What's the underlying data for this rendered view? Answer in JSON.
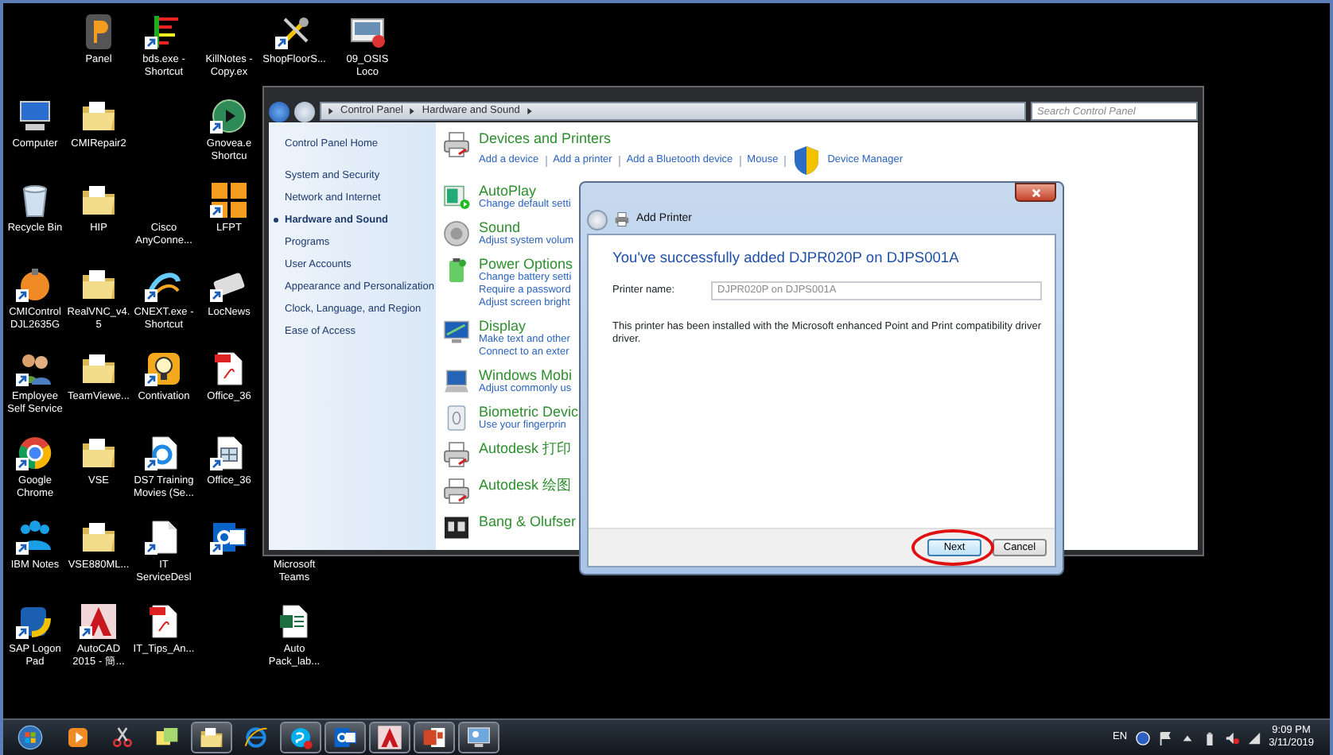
{
  "desktop_rows": [
    [
      null,
      {
        "label": "Panel",
        "kind": "tile",
        "shortcut": false
      },
      {
        "label": "bds.exe - Shortcut",
        "kind": "bars",
        "shortcut": true
      },
      {
        "label": "KillNotes - Copy.ex",
        "kind": "none"
      },
      {
        "label": "ShopFloorS...",
        "kind": "tools",
        "shortcut": true
      },
      {
        "label": "09_OSIS Loco",
        "kind": "slide",
        "shortcut": false
      }
    ],
    [
      {
        "label": "Computer",
        "kind": "computer",
        "shortcut": false
      },
      {
        "label": "CMIRepair2",
        "kind": "folder",
        "shortcut": false
      },
      null,
      {
        "label": "Gnovea.e Shortcu",
        "kind": "play",
        "shortcut": true
      }
    ],
    [
      {
        "label": "Recycle Bin",
        "kind": "bin",
        "shortcut": false
      },
      {
        "label": "HIP",
        "kind": "folder",
        "shortcut": false
      },
      {
        "label": "Cisco AnyConne...",
        "kind": "none"
      },
      {
        "label": "LFPT",
        "kind": "tiles",
        "shortcut": true
      }
    ],
    [
      {
        "label": "CMIControl DJL2635G",
        "kind": "gauge",
        "shortcut": true
      },
      {
        "label": "RealVNC_v4.5",
        "kind": "folder",
        "shortcut": false
      },
      {
        "label": "CNEXT.exe - Shortcut",
        "kind": "swirl",
        "shortcut": true
      },
      {
        "label": "LocNews",
        "kind": "card",
        "shortcut": true
      }
    ],
    [
      {
        "label": "Employee Self Service",
        "kind": "people",
        "shortcut": true
      },
      {
        "label": "TeamViewe...",
        "kind": "folder",
        "shortcut": false
      },
      {
        "label": "Contivation",
        "kind": "bulb",
        "shortcut": true
      },
      {
        "label": "Office_36",
        "kind": "pdf",
        "shortcut": false
      }
    ],
    [
      {
        "label": "Google Chrome",
        "kind": "ring",
        "shortcut": true
      },
      {
        "label": "VSE",
        "kind": "folder",
        "shortcut": false
      },
      {
        "label": "DS7 Training Movies (Se...",
        "kind": "browserpage",
        "shortcut": true
      },
      {
        "label": "Office_36",
        "kind": "sheet",
        "shortcut": true
      }
    ],
    [
      {
        "label": "IBM Notes",
        "kind": "team",
        "shortcut": true
      },
      {
        "label": "VSE880ML...",
        "kind": "folder",
        "shortcut": false
      },
      {
        "label": "IT ServiceDesl",
        "kind": "page",
        "shortcut": true
      },
      {
        "kind": "mail",
        "shortcut": true
      },
      {
        "label": "Microsoft Teams",
        "kind": "none"
      }
    ],
    [
      {
        "label": "SAP Logon Pad",
        "kind": "sap",
        "shortcut": true
      },
      {
        "label": "AutoCAD 2015 - 簡...",
        "kind": "cad",
        "shortcut": true
      },
      {
        "label": "IT_Tips_An...",
        "kind": "pdf",
        "shortcut": false
      },
      null,
      {
        "label": "Auto Pack_lab...",
        "kind": "excel",
        "shortcut": false
      }
    ]
  ],
  "control_panel": {
    "breadcrumb": [
      "Control Panel",
      "Hardware and Sound"
    ],
    "search": {
      "placeholder": "Search Control Panel"
    },
    "nav": [
      {
        "label": "Control Panel Home",
        "selected": false
      },
      {
        "label": "System and Security",
        "selected": false
      },
      {
        "label": "Network and Internet",
        "selected": false
      },
      {
        "label": "Hardware and Sound",
        "selected": true
      },
      {
        "label": "Programs",
        "selected": false
      },
      {
        "label": "User Accounts",
        "selected": false
      },
      {
        "label": "Appearance and Personalization",
        "selected": false
      },
      {
        "label": "Clock, Language, and Region",
        "selected": false
      },
      {
        "label": "Ease of Access",
        "selected": false
      }
    ],
    "categories": [
      {
        "title": "Devices and Printers",
        "kind": "printer",
        "inline": true,
        "links": [
          {
            "label": "Add a device",
            "shield": false
          },
          {
            "label": "Add a printer",
            "shield": false
          },
          {
            "label": "Add a Bluetooth device",
            "shield": false
          },
          {
            "label": "Mouse",
            "shield": false
          },
          {
            "label": "Device Manager",
            "shield": true
          }
        ]
      },
      {
        "title": "AutoPlay",
        "kind": "autoplay",
        "links": [
          {
            "label": "Change default setti",
            "shield": false
          }
        ]
      },
      {
        "title": "Sound",
        "kind": "speaker",
        "links": [
          {
            "label": "Adjust system volum",
            "shield": false
          }
        ]
      },
      {
        "title": "Power Options",
        "kind": "battery",
        "links": [
          {
            "label": "Change battery setti",
            "shield": false
          },
          {
            "label": "Require a password",
            "shield": false
          },
          {
            "label": "Adjust screen bright",
            "shield": false
          }
        ]
      },
      {
        "title": "Display",
        "kind": "display",
        "links": [
          {
            "label": "Make text and other",
            "shield": false
          },
          {
            "label": "Connect to an exter",
            "shield": false
          }
        ]
      },
      {
        "title": "Windows Mobi",
        "kind": "mobility",
        "links": [
          {
            "label": "Adjust commonly us",
            "shield": false
          }
        ]
      },
      {
        "title": "Biometric Devic",
        "kind": "fingerprint",
        "links": [
          {
            "label": "Use your fingerprin",
            "shield": false
          }
        ]
      },
      {
        "title": "Autodesk 打印",
        "kind": "printer"
      },
      {
        "title": "Autodesk 绘图",
        "kind": "printer"
      },
      {
        "title": "Bang & Olufser",
        "kind": "audio"
      }
    ]
  },
  "dialog": {
    "title": "Add Printer",
    "heading": "You've successfully added DJPR020P on DJPS001A",
    "field": {
      "label": "Printer name:",
      "value": "DJPR020P on DJPS001A",
      "disabled": true
    },
    "message": "This printer has been installed with the Microsoft enhanced Point and Print compatibility driver driver.",
    "buttons": [
      {
        "label": "Next",
        "default": true,
        "circled": true
      },
      {
        "label": "Cancel",
        "default": false,
        "circled": false
      }
    ]
  },
  "taskbar": {
    "buttons": [
      {
        "kind": "start",
        "running": false
      },
      {
        "kind": "media",
        "running": false
      },
      {
        "kind": "snip",
        "running": false
      },
      {
        "kind": "notes",
        "running": false
      },
      {
        "kind": "folder",
        "running": true
      },
      {
        "kind": "ie",
        "running": false
      },
      {
        "kind": "skype",
        "running": true
      },
      {
        "kind": "mail",
        "running": true
      },
      {
        "kind": "cad",
        "running": true
      },
      {
        "kind": "ppt",
        "running": true
      },
      {
        "kind": "remote",
        "running": true
      }
    ],
    "language": "EN",
    "time": "9:09 PM",
    "date": "3/11/2019"
  }
}
